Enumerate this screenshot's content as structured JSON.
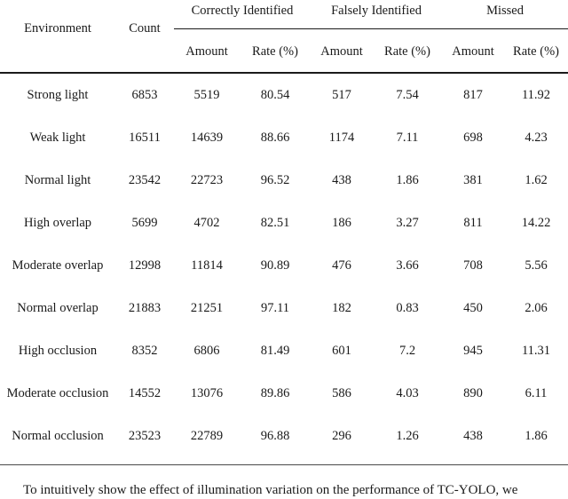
{
  "table": {
    "stub_headers": {
      "environment": "Environment",
      "count": "Count"
    },
    "group_headers": [
      "Correctly Identified",
      "Falsely Identified",
      "Missed"
    ],
    "sub_headers": {
      "amount": "Amount",
      "rate": "Rate (%)"
    },
    "columns": [
      "Environment",
      "Count",
      "Amount",
      "Rate (%)",
      "Amount",
      "Rate (%)",
      "Amount",
      "Rate (%)"
    ],
    "rows": [
      {
        "environment": "Strong light",
        "count": "6853",
        "correct_amount": "5519",
        "correct_rate": "80.54",
        "false_amount": "517",
        "false_rate": "7.54",
        "missed_amount": "817",
        "missed_rate": "11.92"
      },
      {
        "environment": "Weak light",
        "count": "16511",
        "correct_amount": "14639",
        "correct_rate": "88.66",
        "false_amount": "1174",
        "false_rate": "7.11",
        "missed_amount": "698",
        "missed_rate": "4.23"
      },
      {
        "environment": "Normal light",
        "count": "23542",
        "correct_amount": "22723",
        "correct_rate": "96.52",
        "false_amount": "438",
        "false_rate": "1.86",
        "missed_amount": "381",
        "missed_rate": "1.62"
      },
      {
        "environment": "High overlap",
        "count": "5699",
        "correct_amount": "4702",
        "correct_rate": "82.51",
        "false_amount": "186",
        "false_rate": "3.27",
        "missed_amount": "811",
        "missed_rate": "14.22"
      },
      {
        "environment": "Moderate overlap",
        "count": "12998",
        "correct_amount": "11814",
        "correct_rate": "90.89",
        "false_amount": "476",
        "false_rate": "3.66",
        "missed_amount": "708",
        "missed_rate": "5.56"
      },
      {
        "environment": "Normal overlap",
        "count": "21883",
        "correct_amount": "21251",
        "correct_rate": "97.11",
        "false_amount": "182",
        "false_rate": "0.83",
        "missed_amount": "450",
        "missed_rate": "2.06"
      },
      {
        "environment": "High occlusion",
        "count": "8352",
        "correct_amount": "6806",
        "correct_rate": "81.49",
        "false_amount": "601",
        "false_rate": "7.2",
        "missed_amount": "945",
        "missed_rate": "11.31"
      },
      {
        "environment": "Moderate occlusion",
        "count": "14552",
        "correct_amount": "13076",
        "correct_rate": "89.86",
        "false_amount": "586",
        "false_rate": "4.03",
        "missed_amount": "890",
        "missed_rate": "6.11"
      },
      {
        "environment": "Normal occlusion",
        "count": "23523",
        "correct_amount": "22789",
        "correct_rate": "96.88",
        "false_amount": "296",
        "false_rate": "1.26",
        "missed_amount": "438",
        "missed_rate": "1.86"
      }
    ]
  },
  "caption": {
    "text": "To intuitively show the effect of illumination variation on the performance of TC-YOLO, we"
  },
  "colors": {
    "text": "#1a1a1a",
    "rule": "#1a1a1a",
    "rule_light": "#4a4a4a",
    "background": "#ffffff"
  }
}
